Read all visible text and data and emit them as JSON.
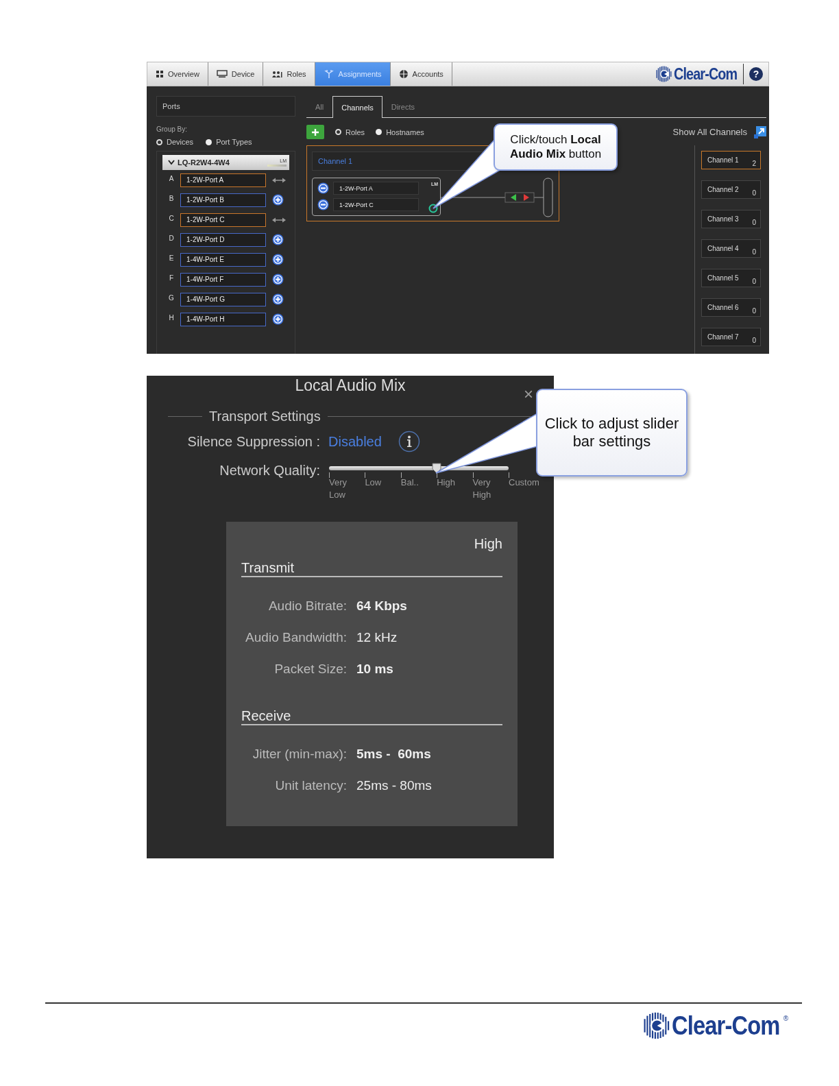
{
  "nav_tabs": [
    {
      "label": "Overview",
      "selected": false
    },
    {
      "label": "Device",
      "selected": false
    },
    {
      "label": "Roles",
      "selected": false
    },
    {
      "label": "Assignments",
      "selected": true
    },
    {
      "label": "Accounts",
      "selected": false
    }
  ],
  "brand": "Clear-Com",
  "help": "?",
  "ports_panel": {
    "title": "Ports",
    "group_by_label": "Group By:",
    "group_by_options": [
      {
        "label": "Devices",
        "selected": true
      },
      {
        "label": "Port Types",
        "selected": false
      }
    ],
    "device": {
      "name": "LQ-R2W4-4W4",
      "badge": "LM",
      "expanded": true,
      "ports": [
        {
          "letter": "A",
          "name": "1-2W-Port A",
          "assigned": true
        },
        {
          "letter": "B",
          "name": "1-2W-Port B",
          "assigned": false
        },
        {
          "letter": "C",
          "name": "1-2W-Port C",
          "assigned": true
        },
        {
          "letter": "D",
          "name": "1-2W-Port D",
          "assigned": false
        },
        {
          "letter": "E",
          "name": "1-4W-Port E",
          "assigned": false
        },
        {
          "letter": "F",
          "name": "1-4W-Port F",
          "assigned": false
        },
        {
          "letter": "G",
          "name": "1-4W-Port G",
          "assigned": false
        },
        {
          "letter": "H",
          "name": "1-4W-Port H",
          "assigned": false
        }
      ]
    }
  },
  "view_tabs": [
    {
      "label": "All",
      "selected": false
    },
    {
      "label": "Channels",
      "selected": true
    },
    {
      "label": "Directs",
      "selected": false
    }
  ],
  "group_options": [
    {
      "label": "Roles",
      "selected": true
    },
    {
      "label": "Hostnames",
      "selected": false
    }
  ],
  "show_all_label": "Show All Channels",
  "channel_card": {
    "name": "Channel 1",
    "badge": "LM",
    "members": [
      {
        "name": "1-2W-Port A"
      },
      {
        "name": "1-2W-Port C"
      }
    ]
  },
  "channels": [
    {
      "name": "Channel 1",
      "count": "2",
      "selected": true
    },
    {
      "name": "Channel 2",
      "count": "0",
      "selected": false
    },
    {
      "name": "Channel 3",
      "count": "0",
      "selected": false
    },
    {
      "name": "Channel 4",
      "count": "0",
      "selected": false
    },
    {
      "name": "Channel 5",
      "count": "0",
      "selected": false
    },
    {
      "name": "Channel 6",
      "count": "0",
      "selected": false
    },
    {
      "name": "Channel 7",
      "count": "0",
      "selected": false
    }
  ],
  "callout": "Click/touch **Local Audio Mix** button",
  "dialog": {
    "title": "Local Audio Mix",
    "close": "×",
    "section": "Transport Settings",
    "silence_label": "Silence Suppression :",
    "silence_value": "Disabled",
    "quality_label": "Network Quality:",
    "quality_stops": [
      "Very Low",
      "Low",
      "Bal..",
      "High",
      "Very High",
      "Custom"
    ],
    "quality": {
      "level": 0.6
    },
    "preset": "High",
    "transmit": {
      "heading": "Transmit",
      "rows": [
        {
          "label": "Audio Bitrate:",
          "value": "64 Kbps",
          "bold": true
        },
        {
          "label": "Audio Bandwidth:",
          "value": "12 kHz",
          "bold": false
        },
        {
          "label": "Packet Size:",
          "value": "10 ms",
          "bold": true
        }
      ]
    },
    "receive": {
      "heading": "Receive",
      "rows": [
        {
          "label": "Jitter (min-max):",
          "value": "5ms -  60ms",
          "bold": true
        },
        {
          "label": "Unit latency:",
          "value": "25ms - 80ms",
          "bold": false
        }
      ]
    },
    "callout": "Click to adjust slider bar settings"
  },
  "footer": {
    "brand": "Clear-Com",
    "registered": "®"
  }
}
